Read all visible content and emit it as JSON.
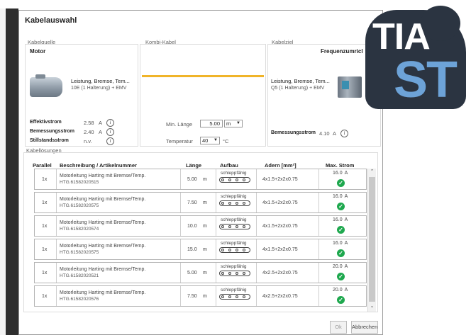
{
  "dialog": {
    "title": "Kabelauswahl",
    "buttons": {
      "ok": "Ok",
      "cancel": "Abbrechen"
    }
  },
  "source": {
    "group_label": "Kabelquelle",
    "device": "Motor",
    "features": "Leistung, Bremse, Tem...",
    "connection": "10E (1 Halterung) + EMV",
    "rows": [
      {
        "label": "Effektivstrom",
        "value": "2.58",
        "unit": "A"
      },
      {
        "label": "Bemessungsstrom",
        "value": "2.40",
        "unit": "A"
      },
      {
        "label": "Stillstandsstrom",
        "value": "n.v.",
        "unit": ""
      }
    ]
  },
  "cable": {
    "group_label": "Kombi-Kabel",
    "min_length_label": "Min. Länge",
    "min_length_value": "5.00",
    "length_unit": "m",
    "temperature_label": "Temperatur",
    "temperature_value": "40",
    "temperature_unit": "°C"
  },
  "target": {
    "group_label": "Kabelziel",
    "device": "Frequenzumricl",
    "features": "Leistung, Bremse, Tem...",
    "connection": "Q5 (1 Halterung) + EMV",
    "rated_current_label": "Bemessungsstrom",
    "rated_current_value": "4.10",
    "rated_current_unit": "A"
  },
  "solutions": {
    "group_label": "Kabellösungen",
    "headers": {
      "parallel": "Parallel",
      "description": "Beschreibung / Artikelnummer",
      "length": "Länge",
      "structure": "Aufbau",
      "cores": "Adern [mm²]",
      "max_current": "Max. Strom"
    },
    "rows": [
      {
        "parallel": "1x",
        "desc": "Motorleitung Harting mit Bremse/Temp.",
        "article": "HTG.61582020515",
        "length": "5.00",
        "unit": "m",
        "structure": "schleppfähig",
        "cores": "4x1.5+2x2x0.75",
        "max_current": "16.0",
        "current_unit": "A"
      },
      {
        "parallel": "1x",
        "desc": "Motorleitung Harting mit Bremse/Temp.",
        "article": "HTG.61582020575",
        "length": "7.50",
        "unit": "m",
        "structure": "schleppfähig",
        "cores": "4x1.5+2x2x0.75",
        "max_current": "16.0",
        "current_unit": "A"
      },
      {
        "parallel": "1x",
        "desc": "Motorleitung Harting mit Bremse/Temp.",
        "article": "HTG.61582020574",
        "length": "10.0",
        "unit": "m",
        "structure": "schleppfähig",
        "cores": "4x1.5+2x2x0.75",
        "max_current": "16.0",
        "current_unit": "A"
      },
      {
        "parallel": "1x",
        "desc": "Motorleitung Harting mit Bremse/Temp.",
        "article": "HTG.61582020575",
        "length": "15.0",
        "unit": "m",
        "structure": "schleppfähig",
        "cores": "4x1.5+2x2x0.75",
        "max_current": "16.0",
        "current_unit": "A"
      },
      {
        "parallel": "1x",
        "desc": "Motorleitung Harting mit Bremse/Temp.",
        "article": "HTG.61582020521",
        "length": "5.00",
        "unit": "m",
        "structure": "schleppfähig",
        "cores": "4x2.5+2x2x0.75",
        "max_current": "20.0",
        "current_unit": "A"
      },
      {
        "parallel": "1x",
        "desc": "Motorleitung Harting mit Bremse/Temp.",
        "article": "HTG.61582020576",
        "length": "7.50",
        "unit": "m",
        "structure": "schleppfähig",
        "cores": "4x2.5+2x2x0.75",
        "max_current": "20.0",
        "current_unit": "A"
      }
    ]
  },
  "logo": {
    "line1": "TIA",
    "line2": "ST"
  },
  "colors": {
    "cable_line": "#f0b429",
    "check_green": "#1ea84e",
    "logo_dark": "#2b3441",
    "logo_blue": "#6da3d8"
  }
}
